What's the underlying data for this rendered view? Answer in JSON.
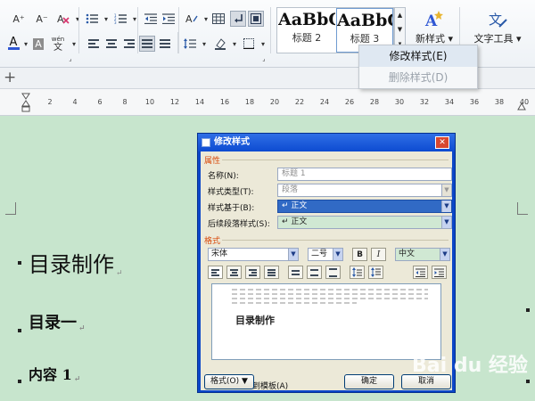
{
  "toolbar": {
    "font_grow": "A⁺",
    "font_shrink": "A⁻",
    "font_color_letter": "A",
    "highlight_letter": "A",
    "phonetic_top": "wén",
    "phonetic_bottom": "文"
  },
  "styles": {
    "gallery": [
      {
        "preview": "AaBbC",
        "label": "标题 2"
      },
      {
        "preview": "AaBbC",
        "label": "标题 3"
      }
    ],
    "new_style_label": "新样式",
    "text_tools_label": "文字工具"
  },
  "style_menu": {
    "items": [
      {
        "label": "修改样式(E)",
        "highlighted": true,
        "enabled": true
      },
      {
        "label": "删除样式(D)",
        "highlighted": false,
        "enabled": false
      }
    ]
  },
  "tabbar": {
    "add_tab": "+"
  },
  "ruler": {
    "ticks": [
      "2",
      "4",
      "6",
      "8",
      "10",
      "12",
      "14",
      "16",
      "18",
      "20",
      "22",
      "24",
      "26",
      "28",
      "30",
      "32",
      "34",
      "36",
      "38",
      "40"
    ]
  },
  "document": {
    "lines": [
      {
        "text": "目录制作"
      },
      {
        "text": "目录一"
      },
      {
        "text": "内容 1"
      }
    ],
    "return_mark": "↵"
  },
  "dialog": {
    "title": "修改样式",
    "close": "✕",
    "properties_section": "属性",
    "name_label": "名称(N):",
    "name_value": "标题 1",
    "type_label": "样式类型(T):",
    "type_value": "段落",
    "based_on_label": "样式基于(B):",
    "based_on_value": "↵ 正文",
    "following_label": "后续段落样式(S):",
    "following_value": "↵ 正文",
    "format_section": "格式",
    "font_name": "宋体",
    "font_size": "二号",
    "bold": "B",
    "italic": "I",
    "script": "中文",
    "preview_text": "目录制作",
    "save_to_template": "同时保存到模板(A)",
    "format_button": "格式(O) ▼",
    "ok": "确定",
    "cancel": "取消"
  },
  "watermark": "Bai du 经验"
}
